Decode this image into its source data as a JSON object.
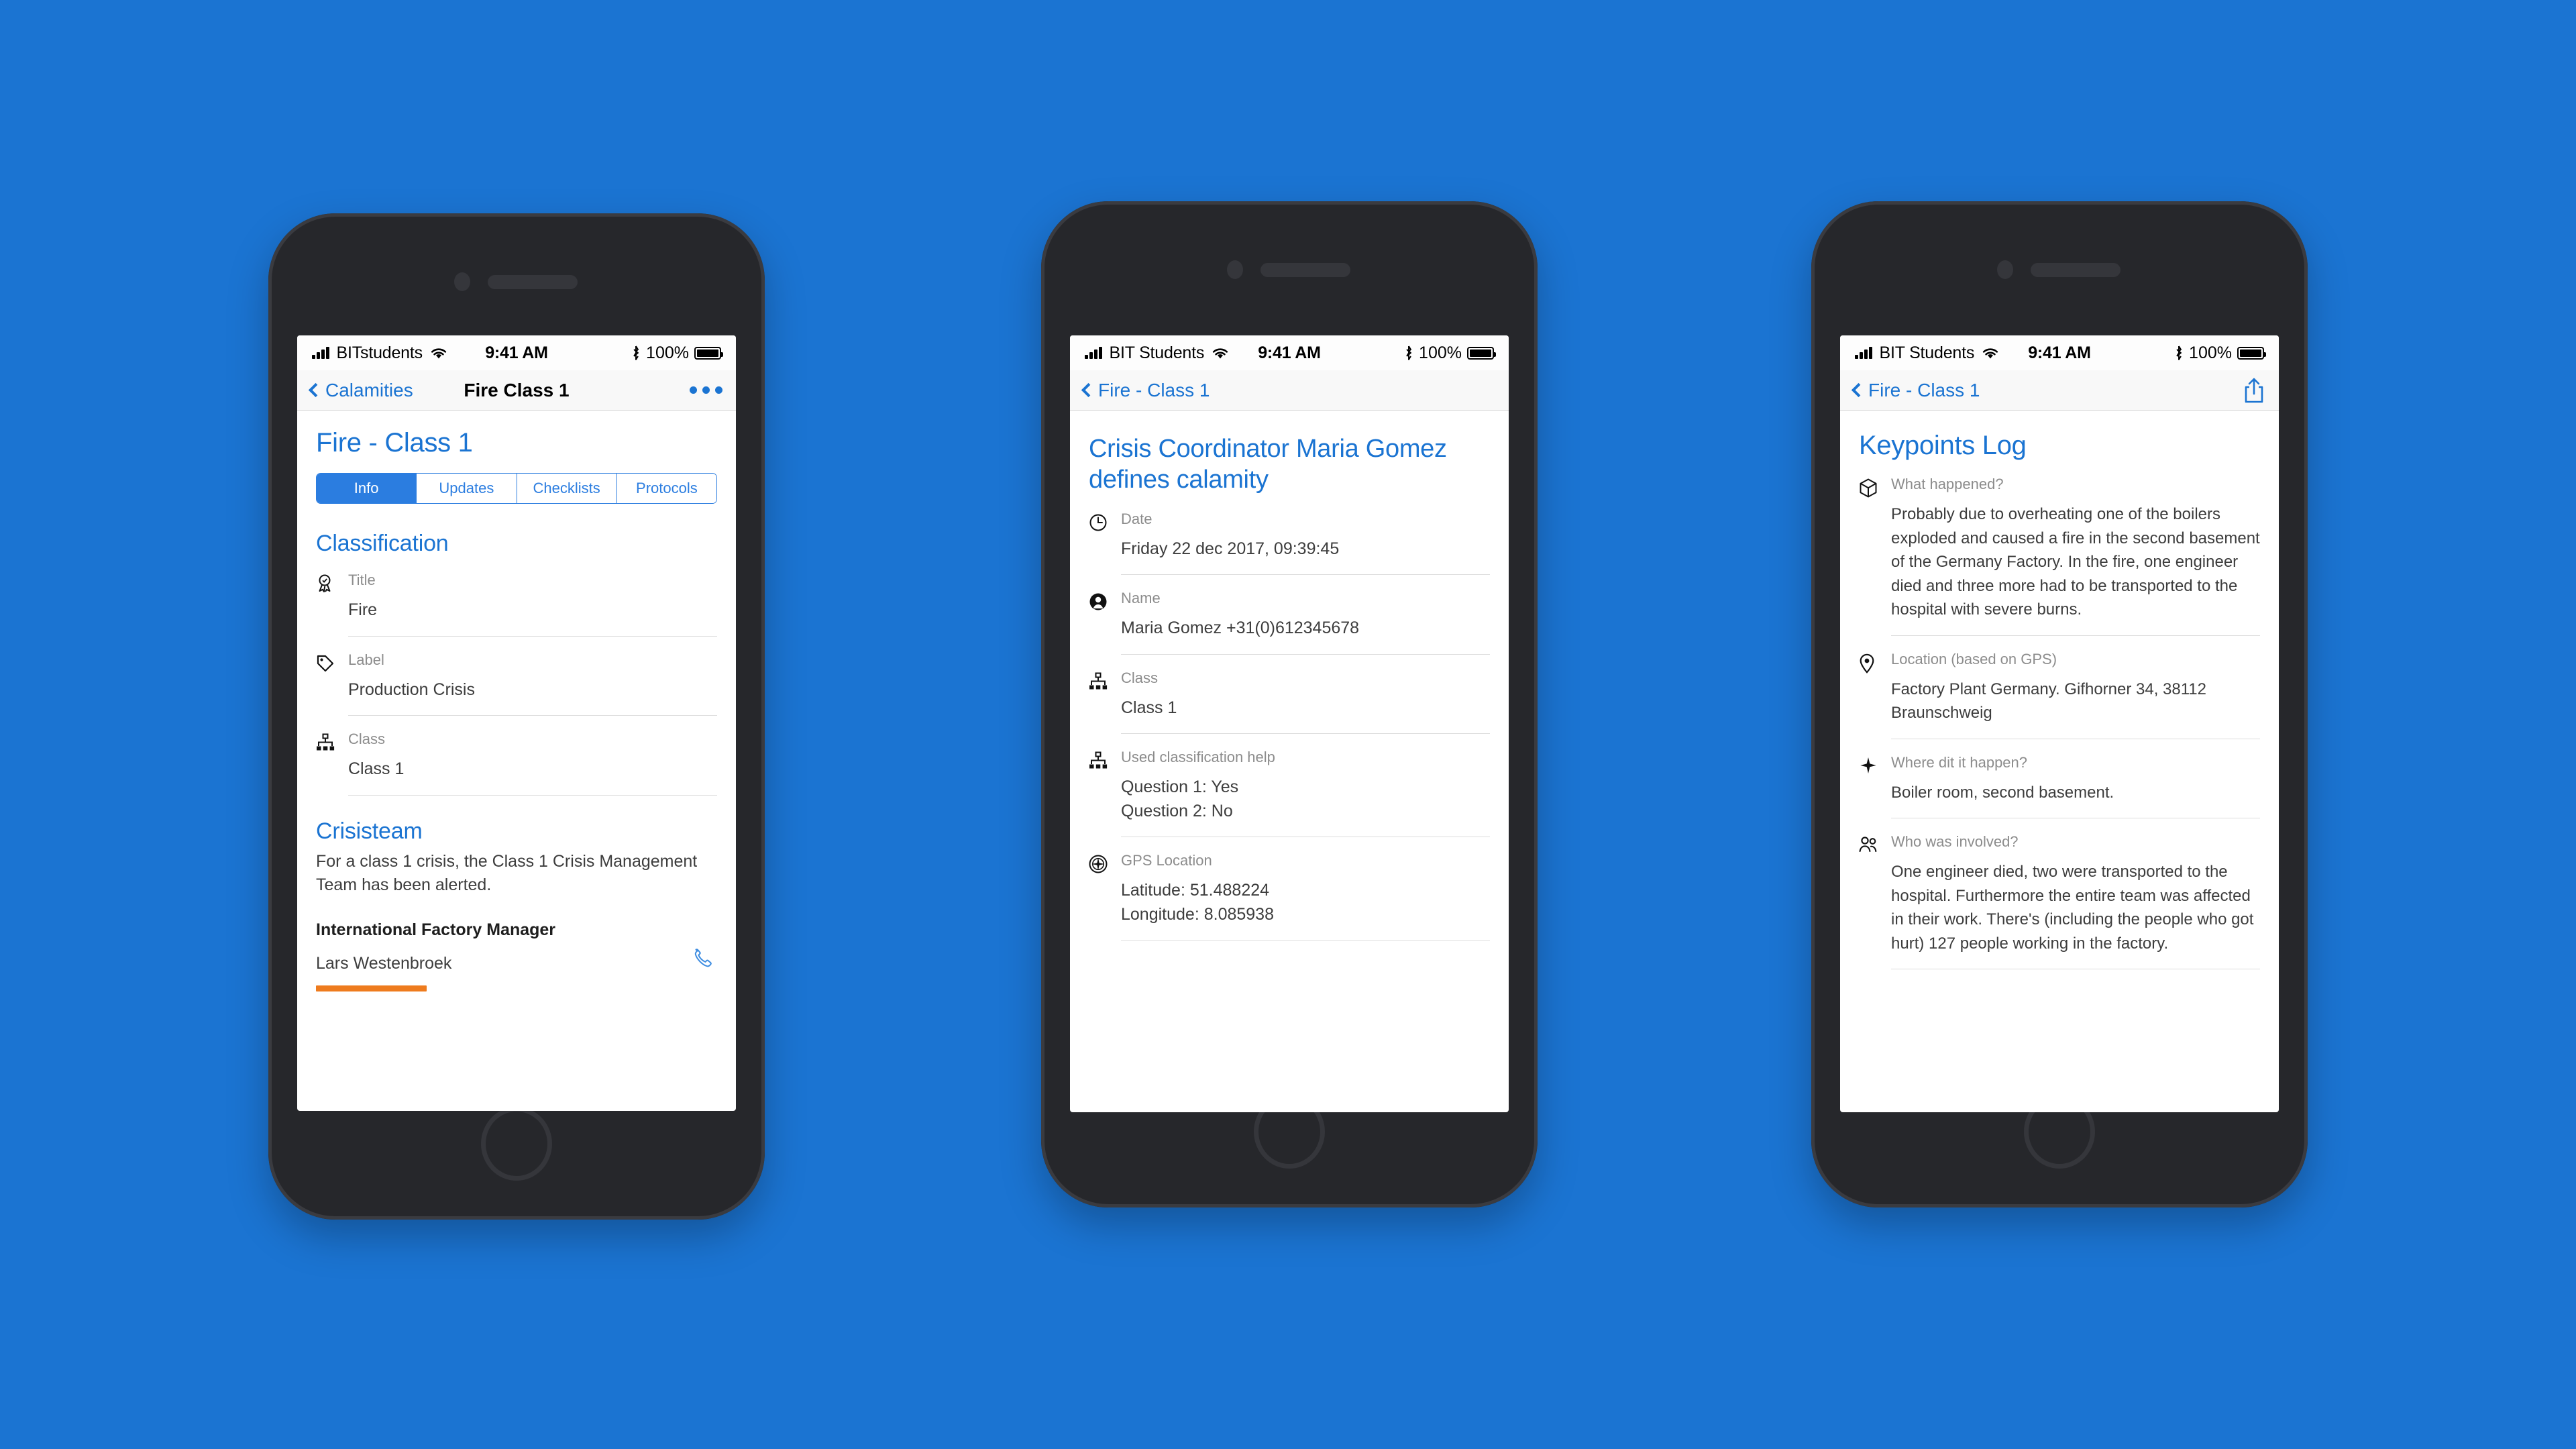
{
  "background_color": "#1B74D2",
  "accent_color": "#1B74D2",
  "phones": [
    {
      "id": "phone-1",
      "status_bar": {
        "carrier": "BITstudents",
        "time": "9:41 AM",
        "battery_percent": "100%"
      },
      "nav": {
        "back_label": "Calamities",
        "title": "Fire Class 1",
        "right_icon": "more-dots-icon"
      },
      "page_title": "Fire - Class 1",
      "tabs": [
        {
          "label": "Info",
          "active": true
        },
        {
          "label": "Updates",
          "active": false
        },
        {
          "label": "Checklists",
          "active": false
        },
        {
          "label": "Protocols",
          "active": false
        }
      ],
      "sections": [
        {
          "heading": "Classification",
          "fields": [
            {
              "icon": "award-ribbon-icon",
              "label": "Title",
              "value": "Fire"
            },
            {
              "icon": "tag-icon",
              "label": "Label",
              "value": "Production Crisis"
            },
            {
              "icon": "org-chart-icon",
              "label": "Class",
              "value": "Class 1"
            }
          ]
        },
        {
          "heading": "Crisisteam",
          "description": "For a class 1 crisis, the Class 1 Crisis Management Team has been alerted.",
          "role": "International Factory Manager",
          "person": "Lars Westenbroek",
          "call_icon": "phone-handset-icon",
          "accent_bar_color": "#EE7B1E"
        }
      ]
    },
    {
      "id": "phone-2",
      "status_bar": {
        "carrier": "BIT Students",
        "time": "9:41 AM",
        "battery_percent": "100%"
      },
      "nav": {
        "back_label": "Fire - Class 1",
        "title": "",
        "right_icon": ""
      },
      "page_title": "Crisis Coordinator Maria Gomez defines calamity",
      "fields": [
        {
          "icon": "clock-icon",
          "label": "Date",
          "value": "Friday 22 dec 2017, 09:39:45"
        },
        {
          "icon": "person-circle-icon",
          "label": "Name",
          "value": "Maria Gomez +31(0)612345678"
        },
        {
          "icon": "org-chart-icon",
          "label": "Class",
          "value": "Class 1"
        },
        {
          "icon": "org-chart-icon",
          "label": "Used classification help",
          "value": "Question 1: Yes\nQuestion 2: No"
        },
        {
          "icon": "compass-icon",
          "label": "GPS Location",
          "value": "Latitude: 51.488224\nLongitude: 8.085938"
        }
      ]
    },
    {
      "id": "phone-3",
      "status_bar": {
        "carrier": "BIT Students",
        "time": "9:41 AM",
        "battery_percent": "100%"
      },
      "nav": {
        "back_label": "Fire - Class 1",
        "title": "",
        "right_icon": "share-icon"
      },
      "page_title": "Keypoints Log",
      "fields": [
        {
          "icon": "cube-icon",
          "label": "What happened?",
          "value": "Probably due to overheating one of the boilers exploded and caused a fire in the second basement of the Germany Factory. In the fire, one engineer died and three more had to be transported to the hospital with severe burns."
        },
        {
          "icon": "map-pin-icon",
          "label": "Location (based on GPS)",
          "value": "Factory Plant Germany. Gifhorner 34, 38112 Braunschweig"
        },
        {
          "icon": "sparkle-icon",
          "label": "Where dit it happen?",
          "value": "Boiler room, second basement."
        },
        {
          "icon": "people-icon",
          "label": "Who was involved?",
          "value": "One engineer died, two were transported to the hospital. Furthermore the entire team was affected in their work. There's (including the people who got hurt) 127 people working in the factory."
        }
      ]
    }
  ]
}
